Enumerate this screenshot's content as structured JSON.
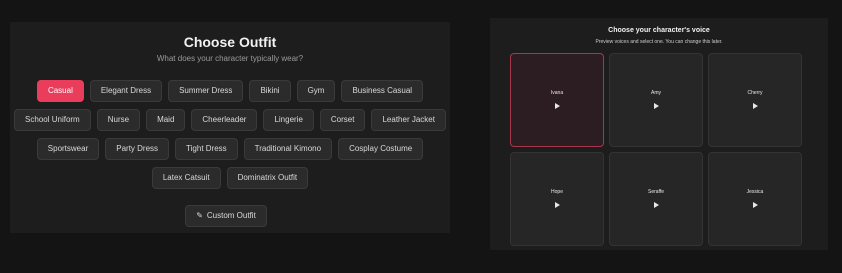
{
  "outfit": {
    "title": "Choose Outfit",
    "subtitle": "What does your character typically wear?",
    "rows": [
      [
        "Casual",
        "Elegant Dress",
        "Summer Dress",
        "Bikini",
        "Gym",
        "Business Casual"
      ],
      [
        "School Uniform",
        "Nurse",
        "Maid",
        "Cheerleader",
        "Lingerie",
        "Corset",
        "Leather Jacket"
      ],
      [
        "Sportswear",
        "Party Dress",
        "Tight Dress",
        "Traditional Kimono",
        "Cosplay Costume"
      ],
      [
        "Latex Catsuit",
        "Dominatrix Outfit"
      ]
    ],
    "selected": "Casual",
    "custom_label": "Custom Outfit",
    "custom_icon": "pencil-icon",
    "accent_color": "#ea3d5c"
  },
  "voice": {
    "title": "Choose your character's voice",
    "subtitle": "Preview voices and select one. You can change this later.",
    "voices": [
      "Ivana",
      "Amy",
      "Cherry",
      "Hope",
      "Seraffe",
      "Jessica"
    ],
    "selected": "Ivana",
    "play_icon": "play-icon"
  }
}
